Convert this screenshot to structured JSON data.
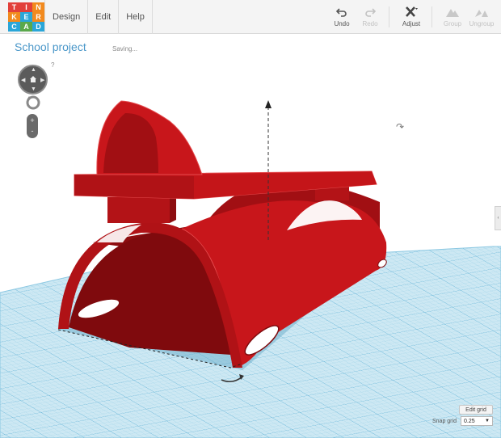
{
  "app": {
    "logo_letters": [
      "T",
      "I",
      "N",
      "K",
      "E",
      "R",
      "C",
      "A",
      "D"
    ],
    "logo_colors": [
      "#e2403a",
      "#e2403a",
      "#f28a1e",
      "#f28a1e",
      "#2aa6d8",
      "#f28a1e",
      "#2aa6d8",
      "#5aa84b",
      "#2aa6d8"
    ]
  },
  "menu": [
    {
      "label": "Design"
    },
    {
      "label": "Edit"
    },
    {
      "label": "Help"
    }
  ],
  "toolbar": {
    "undo": {
      "label": "Undo",
      "icon": "undo-icon",
      "enabled": true
    },
    "redo": {
      "label": "Redo",
      "icon": "redo-icon",
      "enabled": false
    },
    "adjust": {
      "label": "Adjust",
      "icon": "adjust-icon",
      "enabled": true
    },
    "group": {
      "label": "Group",
      "icon": "group-icon",
      "enabled": false
    },
    "ungroup": {
      "label": "Ungroup",
      "icon": "ungroup-icon",
      "enabled": false
    }
  },
  "project": {
    "title": "School project",
    "status": "Saving..."
  },
  "view_controls": {
    "help": "?",
    "zoom_in": "+",
    "zoom_out": "-"
  },
  "grid": {
    "edit_label": "Edit grid",
    "snap_label": "Snap grid",
    "snap_value": "0.25"
  },
  "colors": {
    "model": "#c8161b",
    "workplane": "#c6e5f2",
    "grid_line": "#7fc2e0",
    "title": "#4a97c9"
  }
}
